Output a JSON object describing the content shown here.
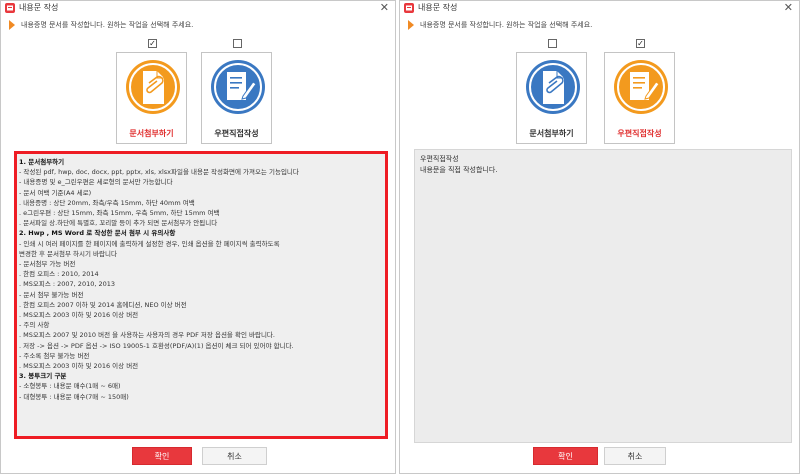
{
  "left_dialog": {
    "title": "내용문 작성",
    "close_symbol": "✕",
    "instruction": "내용증명 문서를 작성합니다. 원하는 작업을 선택해 주세요.",
    "option_attach": {
      "checked": true,
      "label": "문서첨부하기",
      "icon": "document-clip-icon"
    },
    "option_direct": {
      "checked": false,
      "label": "우편직접작성",
      "icon": "edit-document-icon"
    },
    "info_lines": [
      {
        "text": "1. 문서첨부하기",
        "heading": true
      },
      {
        "text": " - 작성된 pdf, hwp, doc, docx, ppt, pptx, xls, xlsx파일을 내용문 작성화면에 가져오는 기능입니다",
        "heading": false
      },
      {
        "text": " - 내용증명 및 e_그린우편은 세로형의 문서만 가능합니다",
        "heading": false
      },
      {
        "text": " - 문서 여백 기준(A4 세로)",
        "heading": false
      },
      {
        "text": "   . 내용증명 : 상단 20mm, 좌측/우측 15mm, 하단 40mm 여백",
        "heading": false
      },
      {
        "text": "   . e그린우편 : 상단 15mm, 좌측 15mm, 우측 5mm, 하단 15mm 여백",
        "heading": false
      },
      {
        "text": "   . 문서파일 상.하단에 특별호, 꼬리말 등이 추가 되면 문서첨부가 안됩니다",
        "heading": false
      },
      {
        "text": "2. Hwp , MS Word 로 작성한 문서 첨부 시  유의사항",
        "heading": true
      },
      {
        "text": " - 인쇄 시 여러 페이지를 한 페이지에  출력하게 설정한 경우, 인쇄 옵션을 한 페이지씩 출력하도록",
        "heading": false
      },
      {
        "text": "   변경한 후 문서첨부 하시기 바랍니다",
        "heading": false
      },
      {
        "text": " - 문서첨부 가능 버전",
        "heading": false
      },
      {
        "text": "   . 한컴 오피스 : 2010, 2014",
        "heading": false
      },
      {
        "text": "   . MS오피스 : 2007, 2010, 2013",
        "heading": false
      },
      {
        "text": " - 문서 첨부 불가능 버전",
        "heading": false
      },
      {
        "text": "   . 한컴 오피스 2007 이하 및 2014 홈에디션, NEO 이상 버전",
        "heading": false
      },
      {
        "text": "   . MS오피스 2003 이하 및 2016 이상 버전",
        "heading": false
      },
      {
        "text": " - 주의 사항",
        "heading": false
      },
      {
        "text": "   . MS오피스 2007 및 2010 버전 을 사용하는 사용자의 경우 PDF 저장 옵션을 확인 바랍니다.",
        "heading": false
      },
      {
        "text": "   . 저장 -> 옵션 -> PDF 옵션 -> ISO 19005-1 호환성(PDF/A)(1) 옵션이 체크 되어 있어야 합니다.",
        "heading": false
      },
      {
        "text": " - 주소록 첨부 불가능 버전",
        "heading": false
      },
      {
        "text": "   . MS오피스 2003 이하 및 2016 이상 버전",
        "heading": false
      },
      {
        "text": "3. 봉투크기 구분",
        "heading": true
      },
      {
        "text": " - 소형봉투 : 내용문 매수(1매 ~ 6매)",
        "heading": false
      },
      {
        "text": " - 대형봉투 : 내용문 매수(7매 ~ 150매)",
        "heading": false
      }
    ],
    "ok_label": "확인",
    "cancel_label": "취소"
  },
  "right_dialog": {
    "title": "내용문 작성",
    "close_symbol": "✕",
    "instruction": "내용증명 문서를 작성합니다. 원하는 작업을 선택해 주세요.",
    "option_attach": {
      "checked": false,
      "label": "문서첨부하기",
      "icon": "document-clip-icon"
    },
    "option_direct": {
      "checked": true,
      "label": "우편직접작성",
      "icon": "edit-document-icon"
    },
    "info_lines": [
      {
        "text": "우편직접작성",
        "heading": false
      },
      {
        "text": "내용문을 직접 작성합니다.",
        "heading": false
      }
    ],
    "ok_label": "확인",
    "cancel_label": "취소"
  },
  "colors": {
    "accent_red": "#e8383d",
    "attach_orange": "#f39a1e",
    "direct_blue": "#3a78c2"
  }
}
